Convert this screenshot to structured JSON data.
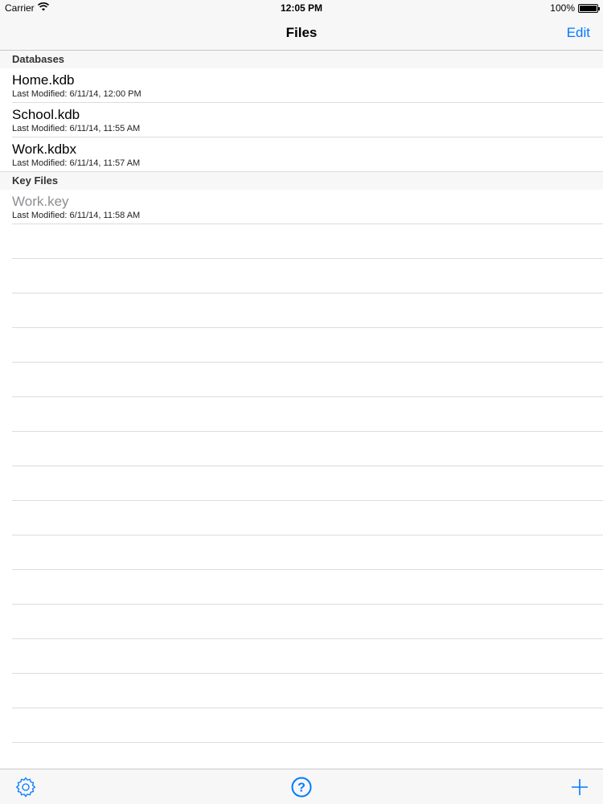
{
  "status_bar": {
    "carrier": "Carrier",
    "time": "12:05 PM",
    "battery": "100%",
    "battery_level": 1.0
  },
  "nav": {
    "title": "Files",
    "edit_label": "Edit"
  },
  "sections": {
    "databases": {
      "header": "Databases",
      "items": [
        {
          "name": "Home.kdb",
          "modified": "Last Modified: 6/11/14, 12:00 PM"
        },
        {
          "name": "School.kdb",
          "modified": "Last Modified: 6/11/14, 11:55 AM"
        },
        {
          "name": "Work.kdbx",
          "modified": "Last Modified: 6/11/14, 11:57 AM"
        }
      ]
    },
    "key_files": {
      "header": "Key Files",
      "items": [
        {
          "name": "Work.key",
          "modified": "Last Modified: 6/11/14, 11:58 AM"
        }
      ]
    }
  },
  "toolbar": {
    "icons": [
      "gear-icon",
      "help-icon",
      "plus-icon"
    ],
    "accent": "#007aff"
  }
}
